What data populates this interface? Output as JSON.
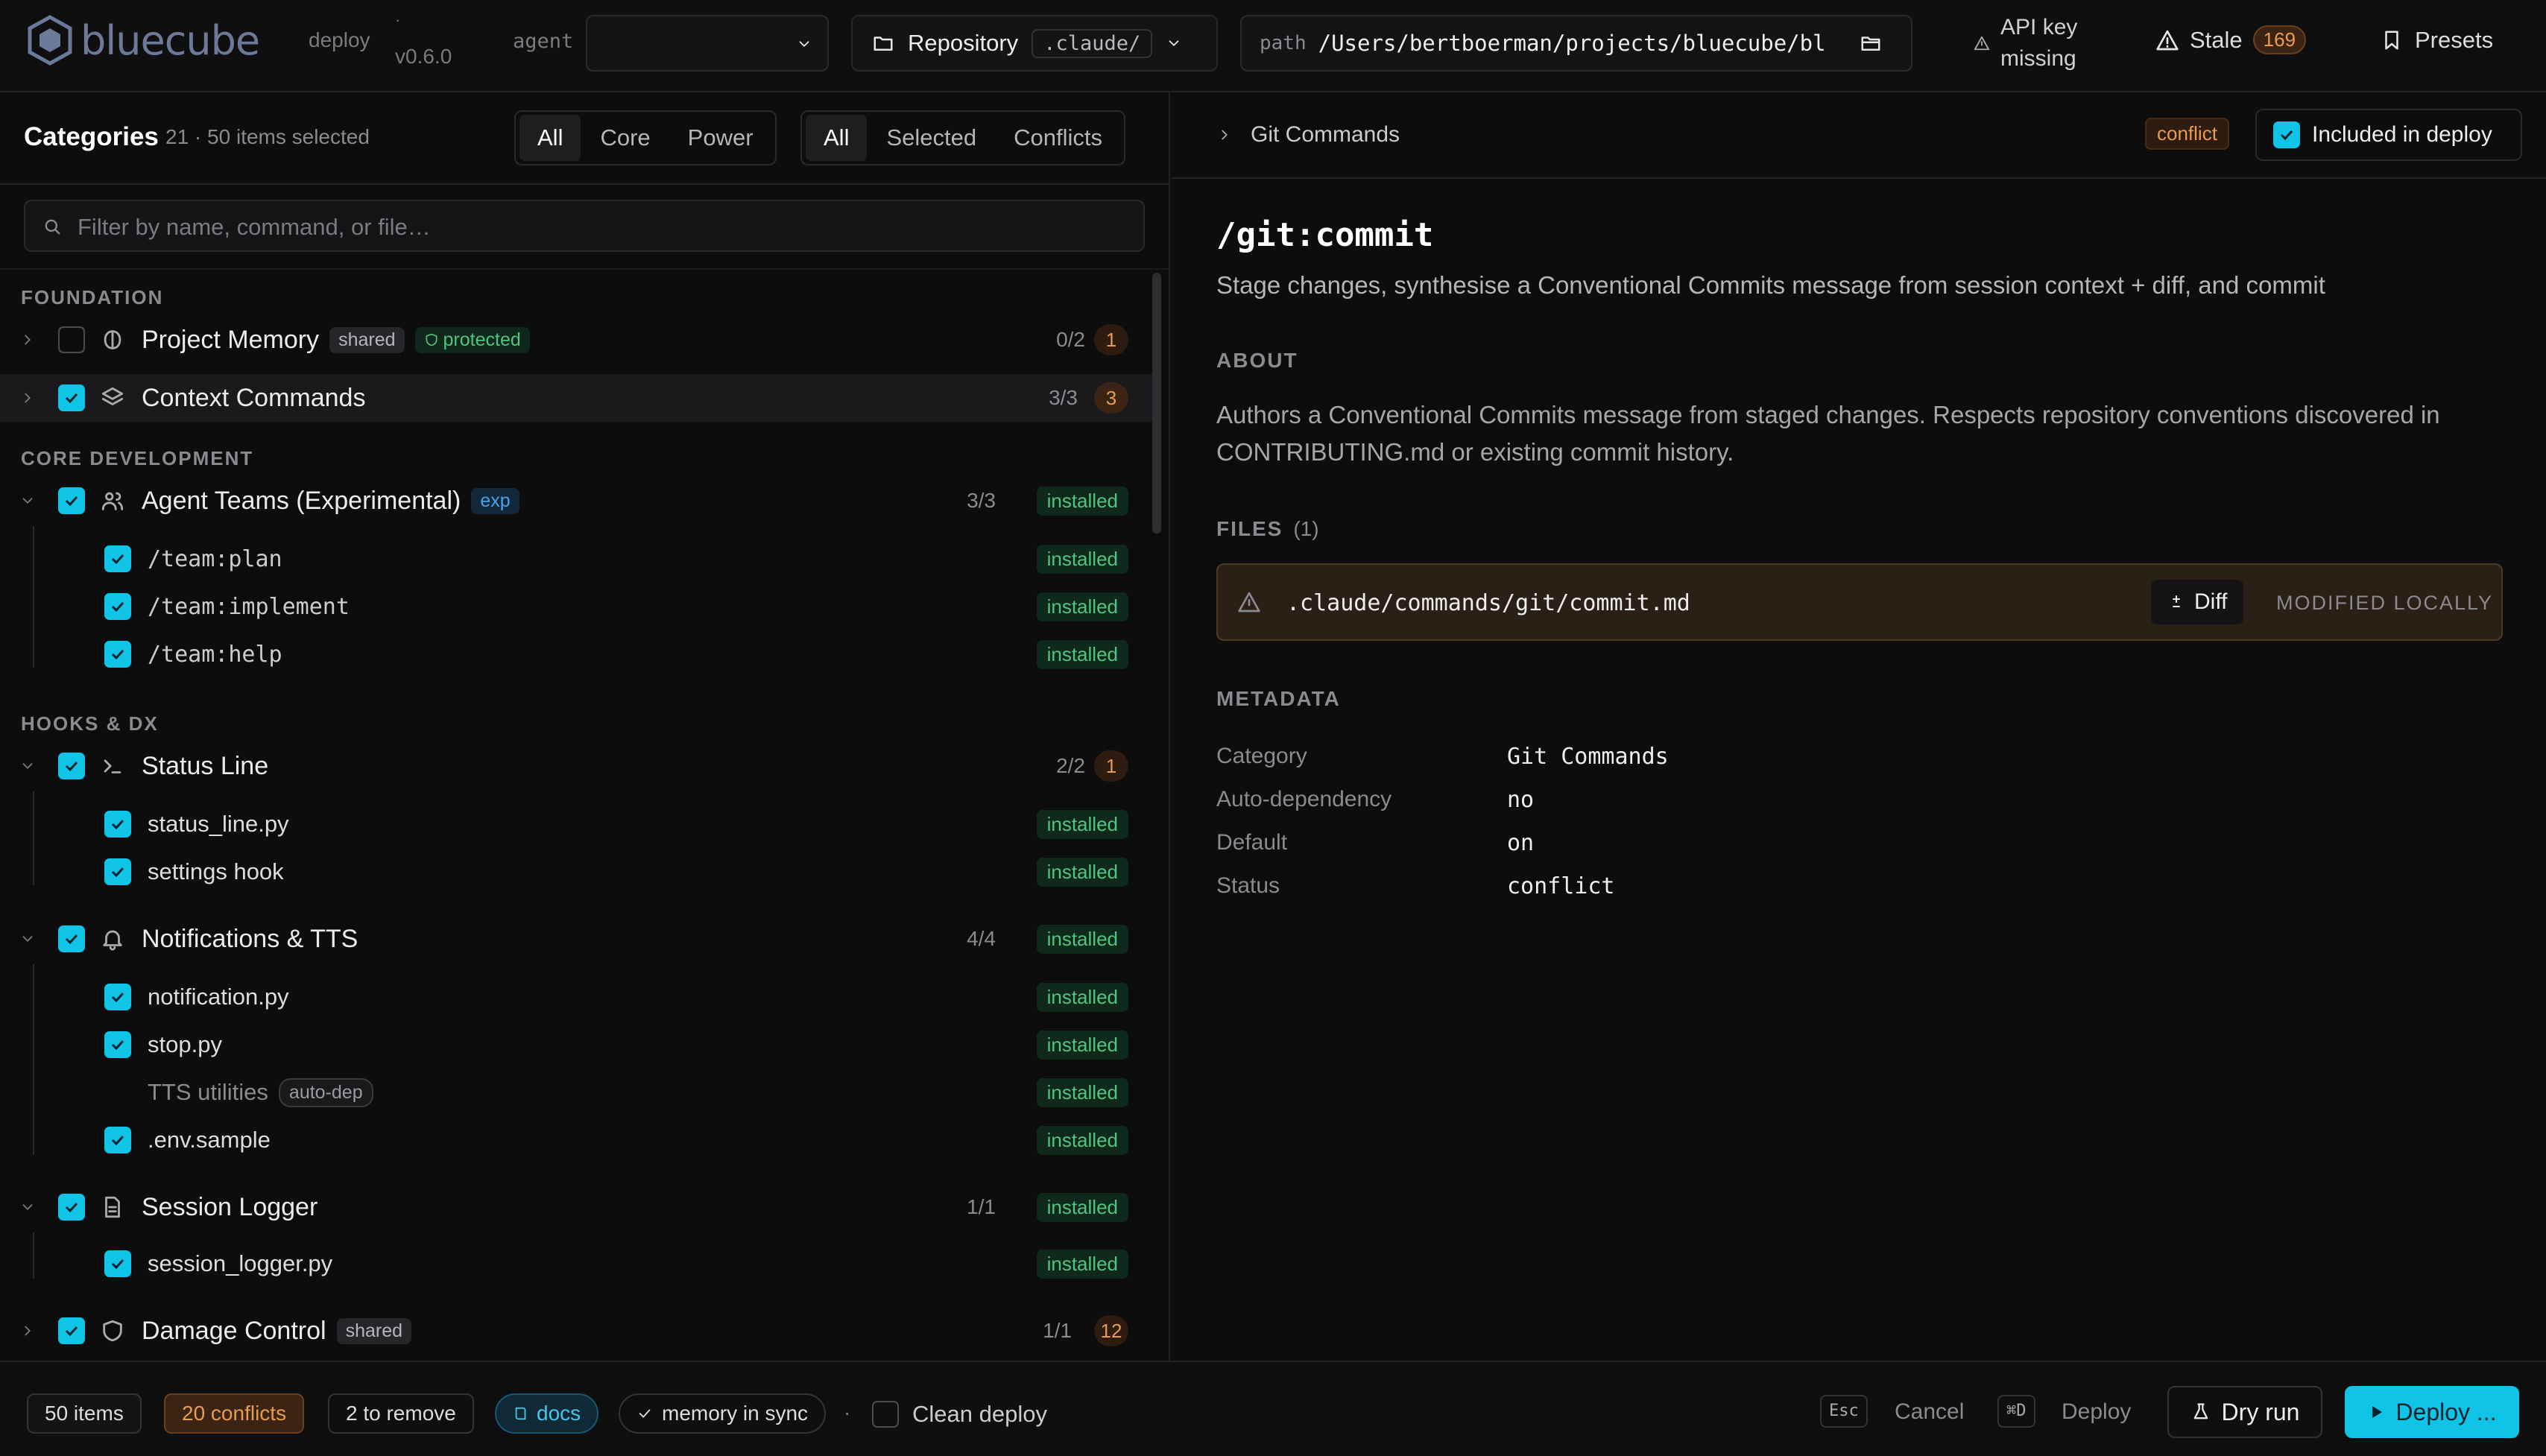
{
  "app": {
    "name": "bluecube",
    "mode": "deploy",
    "dot": "·",
    "version": "v0.6.0"
  },
  "top": {
    "agent_label": "agent",
    "agent_value": "",
    "repo_label": "Repository",
    "repo_chip": ".claude/",
    "path_label": "path",
    "path_value": "/Users/bertboerman/projects/bluecube/bl",
    "api_line1": "API key",
    "api_line2": "missing",
    "stale_label": "Stale",
    "stale_count": "169",
    "presets_label": "Presets"
  },
  "left": {
    "title": "Categories",
    "subtitle": "21 · 50 items selected",
    "seg1": [
      "All",
      "Core",
      "Power"
    ],
    "seg2": [
      "All",
      "Selected",
      "Conflicts"
    ],
    "filter_placeholder": "Filter by name, command, or file…"
  },
  "sections": {
    "foundation": "FOUNDATION",
    "core": "CORE DEVELOPMENT",
    "hooks": "HOOKS & DX"
  },
  "cats": {
    "memory": {
      "title": "Project Memory",
      "badge1": "shared",
      "badge2": "protected",
      "frac": "0/2",
      "count": "1"
    },
    "context": {
      "title": "Context Commands",
      "frac": "3/3",
      "count": "3"
    },
    "teams": {
      "title": "Agent Teams (Experimental)",
      "badge": "exp",
      "frac": "3/3",
      "status": "installed"
    },
    "status": {
      "title": "Status Line",
      "frac": "2/2",
      "count": "1"
    },
    "notif": {
      "title": "Notifications & TTS",
      "frac": "4/4",
      "status": "installed"
    },
    "logger": {
      "title": "Session Logger",
      "frac": "1/1",
      "status": "installed"
    },
    "damage": {
      "title": "Damage Control",
      "badge": "shared",
      "frac": "1/1",
      "count": "12"
    }
  },
  "children": {
    "team_plan": "/team:plan",
    "team_impl": "/team:implement",
    "team_help": "/team:help",
    "status_py": "status_line.py",
    "settings_hook": "settings hook",
    "notif_py": "notification.py",
    "stop_py": "stop.py",
    "tts": "TTS utilities",
    "tts_badge": "auto-dep",
    "env": ".env.sample",
    "logger_py": "session_logger.py",
    "installed": "installed"
  },
  "detail": {
    "breadcrumb": "Git Commands",
    "conflict_badge": "conflict",
    "included_label": "Included in deploy",
    "title": "/git:commit",
    "subtitle": "Stage changes, synthesise a Conventional Commits message from session context + diff, and commit",
    "about_label": "ABOUT",
    "about_line1": "Authors a Conventional Commits message from staged changes. Respects repository conventions discovered in",
    "about_line2": "CONTRIBUTING.md or existing commit history.",
    "files_label": "FILES",
    "files_count": "(1)",
    "file_path": ".claude/commands/git/commit.md",
    "diff_label": "Diff",
    "file_status": "MODIFIED LOCALLY",
    "meta_label": "METADATA",
    "meta": [
      {
        "k": "Category",
        "v": "Git Commands"
      },
      {
        "k": "Auto-dependency",
        "v": "no"
      },
      {
        "k": "Default",
        "v": "on"
      },
      {
        "k": "Status",
        "v": "conflict"
      }
    ]
  },
  "bottom": {
    "items": "50 items",
    "conflicts": "20 conflicts",
    "remove": "2 to remove",
    "docs": "docs",
    "memory": "memory in sync",
    "dot": "·",
    "clean": "Clean deploy",
    "esc": "Esc",
    "cancel": "Cancel",
    "cmd": "⌘D",
    "deploy_label": "Deploy",
    "dry": "Dry run",
    "deploy_btn": "Deploy ..."
  },
  "colors": {
    "accent": "#10c4e8",
    "conflict": "#e79a50",
    "installed": "#52c47d"
  }
}
